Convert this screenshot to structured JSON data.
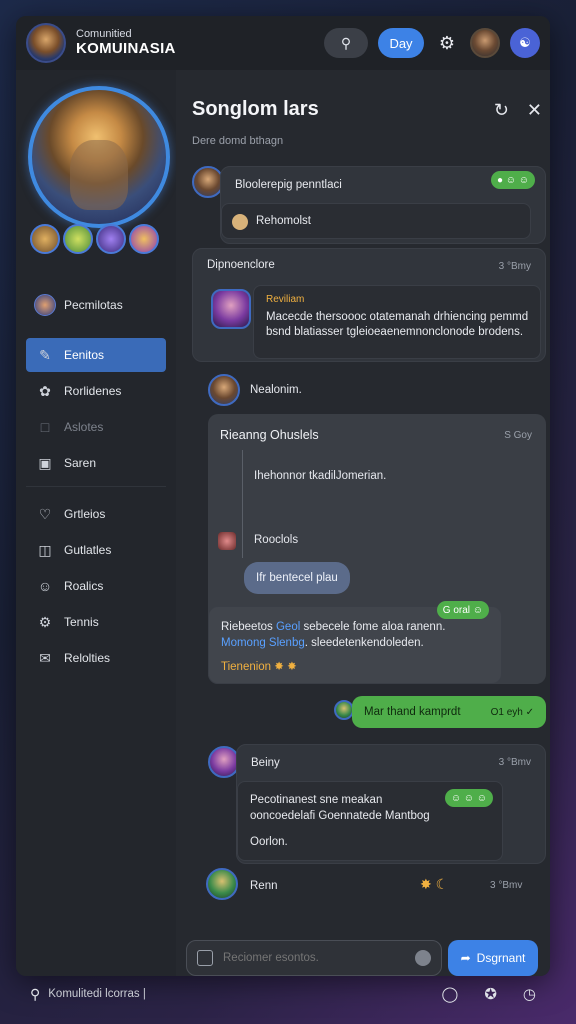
{
  "header": {
    "brand_sub": "Comunitied",
    "brand_title": "KOMUINASIA",
    "day_label": "Day"
  },
  "sidebar": {
    "items": [
      {
        "label": "Pecmilotas",
        "icon": "avatar"
      },
      {
        "label": "Eenitos",
        "icon": "pencil-icon",
        "active": true
      },
      {
        "label": "Rorlidenes",
        "icon": "leaf-icon"
      },
      {
        "label": "Aslotes",
        "icon": "square-icon",
        "muted": true
      },
      {
        "label": "Saren",
        "icon": "window-icon"
      },
      {
        "label": "Grtleios",
        "icon": "heart-icon"
      },
      {
        "label": "Gutlatles",
        "icon": "layout-icon"
      },
      {
        "label": "Roalics",
        "icon": "smile-icon"
      },
      {
        "label": "Tennis",
        "icon": "gear-icon"
      },
      {
        "label": "Relolties",
        "icon": "chat-icon"
      }
    ]
  },
  "chat": {
    "title": "Songlom lars",
    "subtitle": "Dere domd bthagn",
    "messages": {
      "m1": {
        "author": "Bloolerepig penntlaci",
        "reply": "Rehomolst",
        "badge": "● ☺ ☺"
      },
      "m2": {
        "header": "Dipnoenclore",
        "time": "3 °Bmy",
        "author": "Reviliam",
        "text": "Macecde thersoooc otatemanah drhiencing pemmd bsnd blatiasser tgleioeaenemnonclonode brodens."
      },
      "m3": {
        "author": "Nealonim."
      },
      "m4": {
        "title": "Rieanng Ohuslels",
        "time": "S Goy",
        "line1": "Ihehonnor tkadilJomerian.",
        "line2": "Rooclols",
        "bubble": "Ifr bentecel plau"
      },
      "m5": {
        "pre": "Riebeetos ",
        "link1": "Geol",
        "mid": " sebecele fome aloa ranenn. ",
        "link2": "Momong Slenbg",
        "post": ". sleedetenkendoleden.",
        "gold": "Tienenion ✸ ✸",
        "badge": "G oral ☺"
      },
      "m6": {
        "text": "Mar thand kamprdt",
        "time": "O1 eyh ✓"
      },
      "m7": {
        "author": "Beiny",
        "time": "3 °Bmv",
        "line1": "Pecotinanest sne meakan",
        "line2": "ooncoedelafi Goennatede Mantbog",
        "line3": "Oorlon.",
        "badge": "☺ ☺ ☺"
      },
      "m8": {
        "author": "Renn",
        "time": "3 °Bmv"
      }
    }
  },
  "composer": {
    "placeholder": "Reciomer esontos.",
    "send_label": "Dsgrnant"
  },
  "footer": {
    "text": "Komulitedi  lcorras  |"
  }
}
